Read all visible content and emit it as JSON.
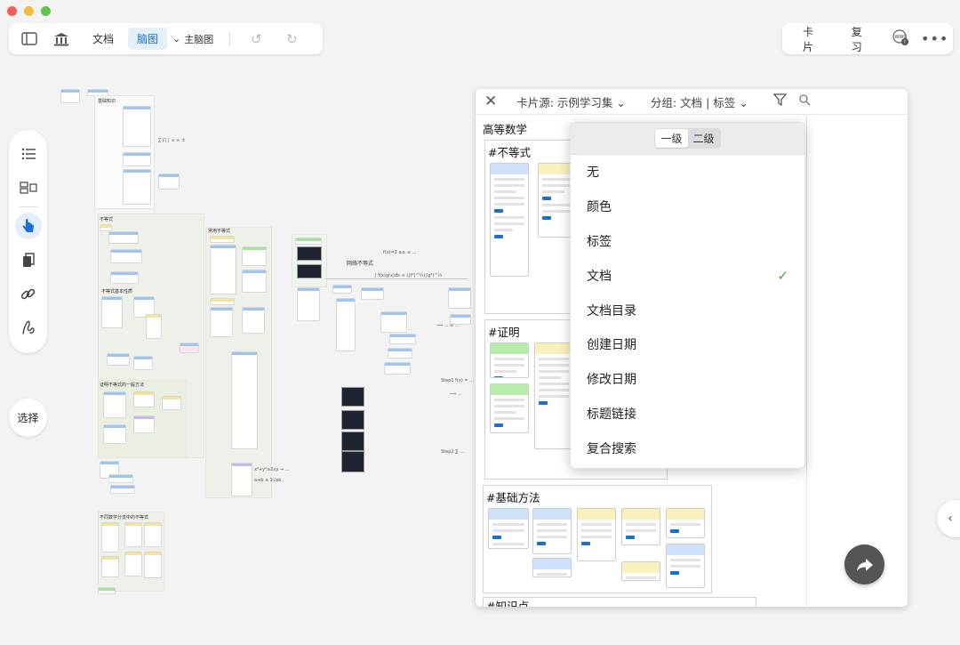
{
  "toolbar_left": {
    "sidebar_icon": "sidebar-toggle-icon",
    "library_icon": "library-icon",
    "tab_document": "文档",
    "tab_mindmap": "脑图",
    "main_mindmap": "主脑图",
    "undo_icon": "undo-icon",
    "redo_icon": "redo-icon"
  },
  "toolbar_right": {
    "cards": "卡片",
    "review": "复习",
    "wwg_icon": "wwg-help-icon",
    "more_icon": "more-icon"
  },
  "sidebar": {
    "icons": [
      "outline-icon",
      "layout-icon",
      "hand-pointer-icon",
      "copy-icon",
      "link-icon",
      "draw-icon"
    ],
    "select_label": "选择"
  },
  "card_panel": {
    "source_label": "卡片源: 示例学习集",
    "group_label": "分组: 文档 | 标签",
    "section_title": "高等数学",
    "tags": [
      "#不等式",
      "#证明",
      "#基础方法",
      "#知识点"
    ]
  },
  "dropdown": {
    "level1": "一级",
    "level2": "二级",
    "items": [
      "无",
      "颜色",
      "标签",
      "文档",
      "文档目录",
      "创建日期",
      "修改日期",
      "标题链接",
      "复合搜索"
    ],
    "checked_item": "文档"
  },
  "mindmap": {
    "texts": [
      "基础知识",
      "不等式",
      "常用不等式",
      "不等式基本性质",
      "证明不等式的一般方法",
      "不同数学分支中的不等式",
      "柯西不等式",
      "均值不等式",
      "网络不等式",
      "多元微分学",
      "不等式链"
    ]
  }
}
